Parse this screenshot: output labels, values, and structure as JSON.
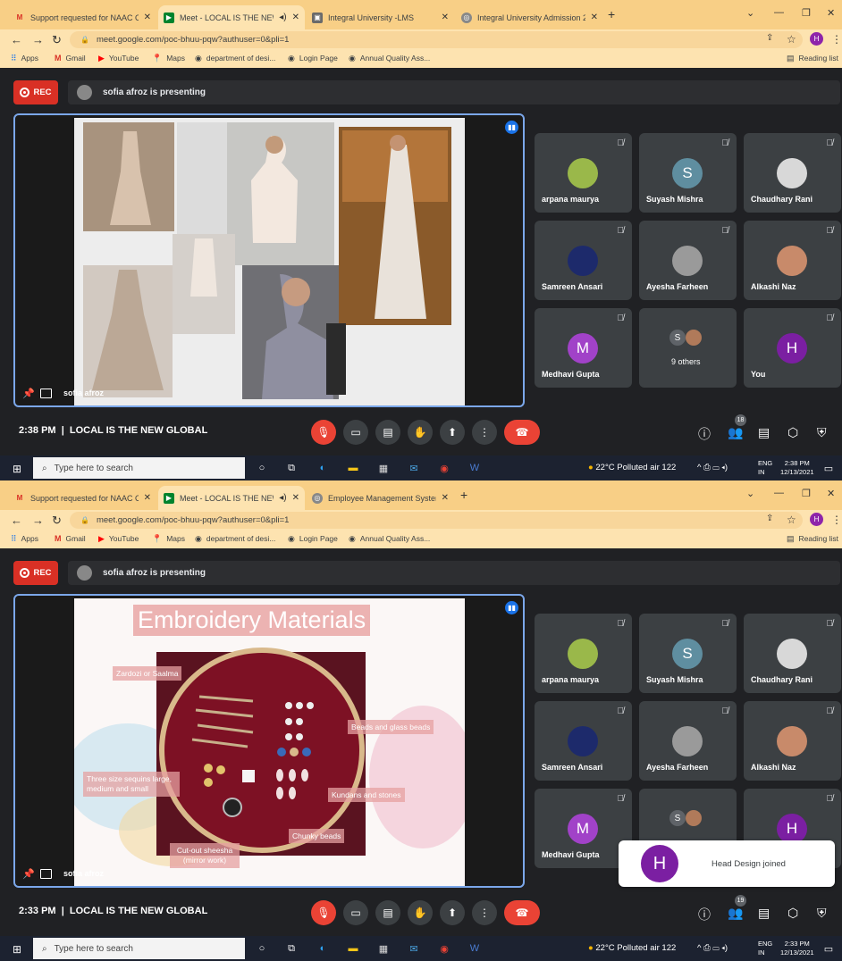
{
  "shots": [
    {
      "tabs": [
        {
          "label": "Support requested for NAAC Cri",
          "icon": "gmail-icon"
        },
        {
          "label": "Meet - LOCAL IS THE NEW G",
          "icon": "meet-icon",
          "active": true
        },
        {
          "label": "Integral University -LMS",
          "icon": "lms-icon"
        },
        {
          "label": "Integral University Admission 20",
          "icon": "globe-icon"
        }
      ],
      "url": "meet.google.com/poc-bhuu-pqw?authuser=0&pli=1",
      "presenting": "sofia afroz is presenting",
      "rec_label": "REC",
      "presenter_name": "sofia afroz",
      "slide_title": "",
      "slide_labels": [],
      "participants": [
        {
          "name": "arpana maurya",
          "initial": "",
          "color": "#9ab84a"
        },
        {
          "name": "Suyash Mishra",
          "initial": "S",
          "color": "#5f8ea0"
        },
        {
          "name": "Chaudhary Rani",
          "initial": "",
          "color": "#d8d8d8"
        },
        {
          "name": "Samreen Ansari",
          "initial": "",
          "color": "#1d2a6b"
        },
        {
          "name": "Ayesha Farheen",
          "initial": "",
          "color": "#9a9a9a"
        },
        {
          "name": "Alkashi Naz",
          "initial": "",
          "color": "#c88a6a"
        },
        {
          "name": "Medhavi Gupta",
          "initial": "M",
          "color": "#a142c8"
        },
        {
          "name": "9 others",
          "initial": "S",
          "color": "#3c4043"
        },
        {
          "name": "You",
          "initial": "H",
          "color": "#7b1fa2"
        }
      ],
      "clock": "2:38 PM",
      "meeting_title": "LOCAL IS THE NEW GLOBAL",
      "people_count": "18",
      "taskbar_time": "2:38 PM",
      "taskbar_date": "12/13/2021"
    },
    {
      "tabs": [
        {
          "label": "Support requested for NAAC Cri",
          "icon": "gmail-icon"
        },
        {
          "label": "Meet - LOCAL IS THE NEW G",
          "icon": "meet-icon",
          "active": true
        },
        {
          "label": "Employee Management System",
          "icon": "globe-icon"
        }
      ],
      "url": "meet.google.com/poc-bhuu-pqw?authuser=0&pli=1",
      "presenting": "sofia afroz is presenting",
      "rec_label": "REC",
      "presenter_name": "sofia afroz",
      "slide_title": "Embroidery Materials",
      "slide_labels": [
        "Zardozi or Saalma",
        "Beads and glass beads",
        "Three size sequins large, medium and small",
        "Kundans and stones",
        "Chunky beads",
        "Cut-out sheesha (mirror work)"
      ],
      "participants": [
        {
          "name": "arpana maurya",
          "initial": "",
          "color": "#9ab84a"
        },
        {
          "name": "Suyash Mishra",
          "initial": "S",
          "color": "#5f8ea0"
        },
        {
          "name": "Chaudhary Rani",
          "initial": "",
          "color": "#d8d8d8"
        },
        {
          "name": "Samreen Ansari",
          "initial": "",
          "color": "#1d2a6b"
        },
        {
          "name": "Ayesha Farheen",
          "initial": "",
          "color": "#9a9a9a"
        },
        {
          "name": "Alkashi Naz",
          "initial": "",
          "color": "#c88a6a"
        },
        {
          "name": "Medhavi Gupta",
          "initial": "M",
          "color": "#a142c8"
        },
        {
          "name": "",
          "initial": "S",
          "color": "#3c4043"
        },
        {
          "name": "",
          "initial": "H",
          "color": "#7b1fa2"
        }
      ],
      "clock": "2:33 PM",
      "meeting_title": "LOCAL IS THE NEW GLOBAL",
      "people_count": "19",
      "taskbar_time": "2:33 PM",
      "taskbar_date": "12/13/2021"
    }
  ],
  "bookmarks": [
    "Apps",
    "Gmail",
    "YouTube",
    "Maps",
    "department of desi...",
    "Login Page",
    "Annual Quality Ass..."
  ],
  "reading_list": "Reading list",
  "taskbar": {
    "search_placeholder": "Type here to search",
    "weather": "22°C  Polluted air 122",
    "lang": "ENG",
    "region": "IN"
  },
  "toast": {
    "initial": "H",
    "text": "Head Design joined"
  },
  "colors": {
    "accent": "#1a73e8",
    "rec": "#d93025",
    "end_call": "#ea4335"
  }
}
